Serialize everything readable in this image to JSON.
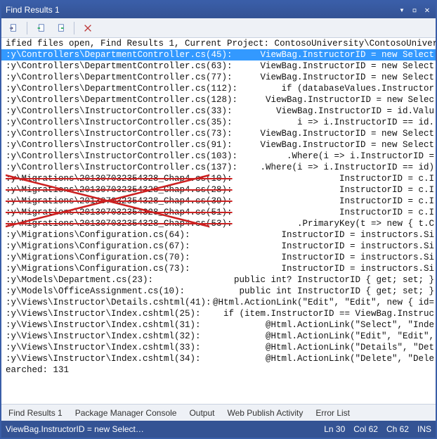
{
  "window": {
    "title": "Find Results 1"
  },
  "header_line": "ified files open, Find Results 1, Current Project: ContosoUniversity\\ContosoUniversit",
  "results": [
    {
      "path": ":y\\Controllers\\DepartmentController.cs(45):",
      "rhs": "ViewBag.InstructorID = new Select",
      "hl": true
    },
    {
      "path": ":y\\Controllers\\DepartmentController.cs(63):",
      "rhs": "ViewBag.InstructorID = new Select"
    },
    {
      "path": ":y\\Controllers\\DepartmentController.cs(77):",
      "rhs": "ViewBag.InstructorID = new Select"
    },
    {
      "path": ":y\\Controllers\\DepartmentController.cs(112):",
      "rhs": "if (databaseValues.Instructor"
    },
    {
      "path": ":y\\Controllers\\DepartmentController.cs(128):",
      "rhs": "ViewBag.InstructorID = new Selec"
    },
    {
      "path": ":y\\Controllers\\InstructorController.cs(33):",
      "rhs": "ViewBag.InstructorID = id.Valu"
    },
    {
      "path": ":y\\Controllers\\InstructorController.cs(35):",
      "rhs": "i => i.InstructorID == id."
    },
    {
      "path": ":y\\Controllers\\InstructorController.cs(73):",
      "rhs": "ViewBag.InstructorID = new Select"
    },
    {
      "path": ":y\\Controllers\\InstructorController.cs(91):",
      "rhs": "ViewBag.InstructorID = new Select"
    },
    {
      "path": ":y\\Controllers\\InstructorController.cs(103):",
      "rhs": ".Where(i => i.InstructorID ="
    },
    {
      "path": ":y\\Controllers\\InstructorController.cs(137):",
      "rhs": ".Where(i => i.InstructorID == id)"
    },
    {
      "path": ":y\\Migrations\\201307032354328_Chap4.cs(10):",
      "rhs": "InstructorID = c.I",
      "strike": true
    },
    {
      "path": ":y\\Migrations\\201307032354328_Chap4.cs(28):",
      "rhs": "InstructorID = c.I",
      "strike": true
    },
    {
      "path": ":y\\Migrations\\201307032354328_Chap4.cs(39):",
      "rhs": "InstructorID = c.I",
      "strike": true
    },
    {
      "path": ":y\\Migrations\\201307032354328_Chap4.cs(51):",
      "rhs": "InstructorID = c.I",
      "strike": true
    },
    {
      "path": ":y\\Migrations\\201307032354328_Chap4.cs(53):",
      "rhs": ".PrimaryKey(t => new { t.C",
      "strike": true
    },
    {
      "path": ":y\\Migrations\\Configuration.cs(64):",
      "rhs": "InstructorID  = instructors.Si"
    },
    {
      "path": ":y\\Migrations\\Configuration.cs(67):",
      "rhs": "InstructorID  = instructors.Si"
    },
    {
      "path": ":y\\Migrations\\Configuration.cs(70):",
      "rhs": "InstructorID  = instructors.Si"
    },
    {
      "path": ":y\\Migrations\\Configuration.cs(73):",
      "rhs": "InstructorID  = instructors.Si"
    },
    {
      "path": ":y\\Models\\Department.cs(23):",
      "rhs": "public int? InstructorID { get; set; }        ",
      "nowrap": true
    },
    {
      "path": ":y\\Models\\OfficeAssignment.cs(10):",
      "rhs": "public int InstructorID { get; set; }  ",
      "nowrap": true
    },
    {
      "path": ":y\\Views\\Instructor\\Details.cshtml(41):",
      "rhs": "@Html.ActionLink(\"Edit\", \"Edit\", new { id="
    },
    {
      "path": ":y\\Views\\Instructor\\Index.cshtml(25):",
      "rhs": "if (item.InstructorID == ViewBag.Instruc"
    },
    {
      "path": ":y\\Views\\Instructor\\Index.cshtml(31):",
      "rhs": "@Html.ActionLink(\"Select\", \"Inde"
    },
    {
      "path": ":y\\Views\\Instructor\\Index.cshtml(32):",
      "rhs": "@Html.ActionLink(\"Edit\", \"Edit\","
    },
    {
      "path": ":y\\Views\\Instructor\\Index.cshtml(33):",
      "rhs": "@Html.ActionLink(\"Details\", \"Det"
    },
    {
      "path": ":y\\Views\\Instructor\\Index.cshtml(34):",
      "rhs": "@Html.ActionLink(\"Delete\", \"Dele"
    }
  ],
  "footer_line": "earched: 131",
  "tabs": [
    "Find Results 1",
    "Package Manager Console",
    "Output",
    "Web Publish Activity",
    "Error List"
  ],
  "statusbar": {
    "left": "ViewBag.InstructorID = new SelectList(db....",
    "ln": "Ln 30",
    "col": "Col 62",
    "ch": "Ch 62",
    "ins": "INS"
  }
}
